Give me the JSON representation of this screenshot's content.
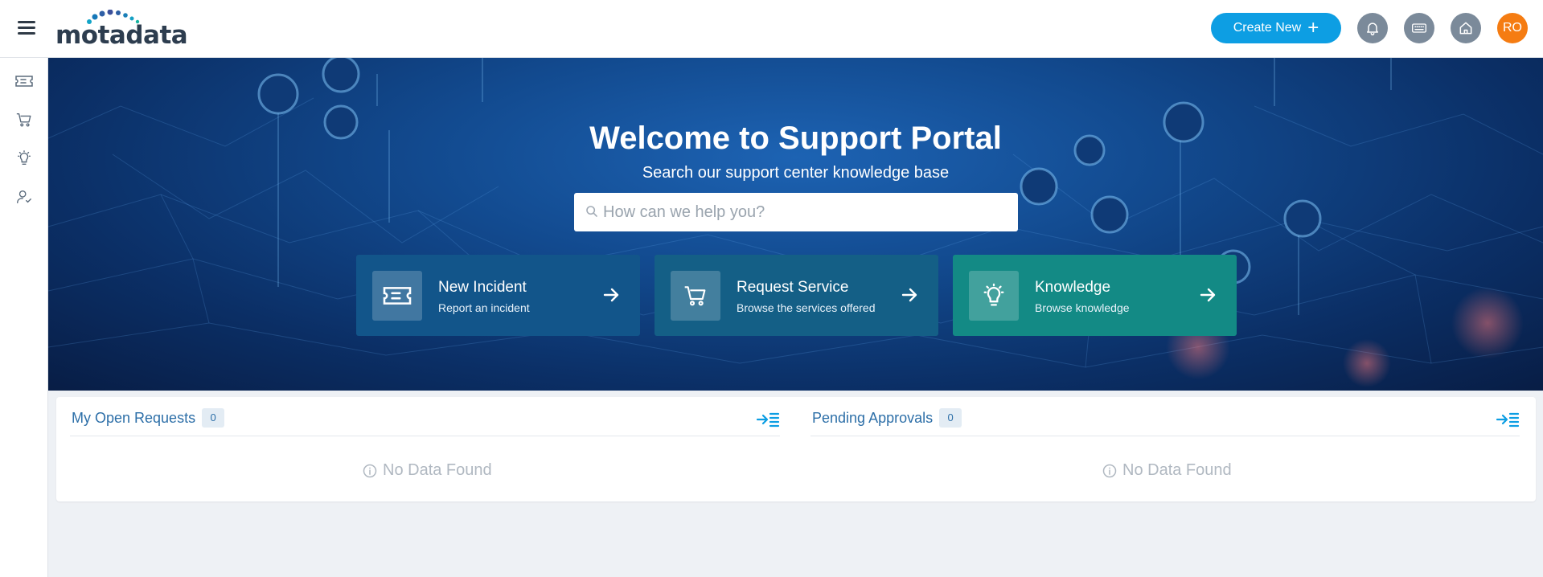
{
  "header": {
    "logo_text": "motadata",
    "create_label": "Create New",
    "create_plus": "+",
    "avatar_initials": "RO",
    "icons": [
      "bell-icon",
      "keyboard-icon",
      "home-icon"
    ]
  },
  "sidebar": {
    "items": [
      {
        "name": "ticket-icon"
      },
      {
        "name": "cart-icon"
      },
      {
        "name": "lightbulb-icon"
      },
      {
        "name": "user-check-icon"
      }
    ]
  },
  "hero": {
    "title": "Welcome to Support Portal",
    "subtitle": "Search our support center knowledge base",
    "search_placeholder": "How can we help you?",
    "tiles": [
      {
        "title": "New Incident",
        "desc": "Report an incident",
        "color": "#12558a"
      },
      {
        "title": "Request Service",
        "desc": "Browse the services offered",
        "color": "#145f86"
      },
      {
        "title": "Knowledge",
        "desc": "Browse knowledge",
        "color": "#138a85"
      }
    ]
  },
  "panel": {
    "open_requests": {
      "label": "My Open Requests",
      "count": "0",
      "empty": "No Data Found"
    },
    "pending_approvals": {
      "label": "Pending Approvals",
      "count": "0",
      "empty": "No Data Found"
    }
  },
  "colors": {
    "accent": "#0d9ee3",
    "avatar": "#f57c12",
    "section_title": "#2d6fa8"
  }
}
